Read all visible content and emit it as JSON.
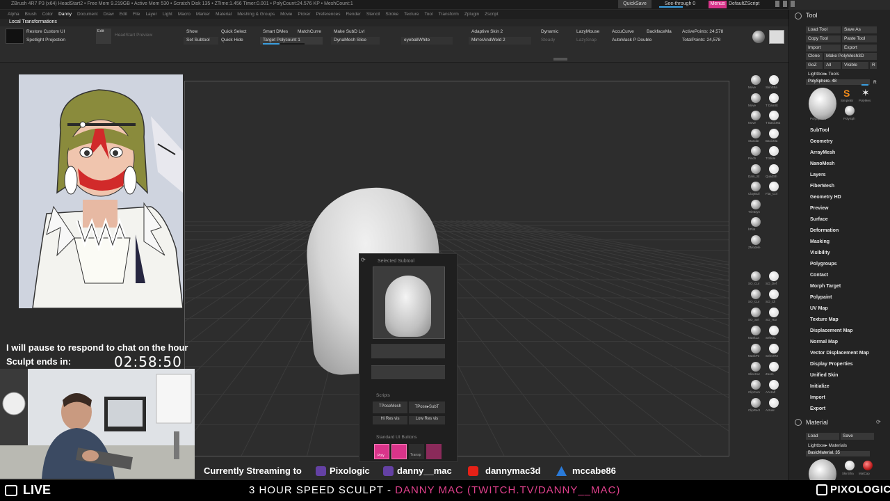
{
  "titlebar": {
    "text": "ZBrush 4R7 P3 (x64)   HeadStart2   • Free Mem 9.219GB • Active Mem 530 • Scratch Disk 135 • ZTime:1.456 Timer:0.001 • PolyCount:24.576 KP • MeshCount:1",
    "quicksave": "QuickSave",
    "seethrough": "See-through 0",
    "menus": "Menus",
    "default_script": "DefaultZScript"
  },
  "menubar": [
    "Alpha",
    "Brush",
    "Color",
    "Danny",
    "Document",
    "Draw",
    "Edit",
    "File",
    "Layer",
    "Light",
    "Macro",
    "Marker",
    "Material",
    "Meshing & Groups",
    "Movie",
    "Picker",
    "Preferences",
    "Render",
    "Stencil",
    "Stroke",
    "Texture",
    "Tool",
    "Transform",
    "Zplugin",
    "Zscript"
  ],
  "menubar_active": "Danny",
  "subbar": "Local Transformations",
  "shelf": {
    "restore_custom_ui": "Restore Custom UI",
    "spotlight_projection": "Spotlight Projection",
    "edit": "Edit",
    "headstart_preview": "HeadStart Preview",
    "show": "Show",
    "quick_select": "Quick Select",
    "set_subtool": "Set Subtool",
    "quick_hide": "Quick Hide",
    "smart_dmesh": "Smart DMes",
    "match_curve": "MatchCurre",
    "make_subd_lvl": "Make SubD Lvl",
    "target_polycount": "Target Polycount 1",
    "dynamesh_slice": "DynaMesh Slice",
    "eyeball_white": "eyeballWhite",
    "adaptive_skin": "Adaptive Skin 2",
    "dynamic": "Dynamic",
    "lazymouse": "LazyMouse",
    "accucurve": "AccuCurve",
    "backface_mask": "BackfaceMa",
    "active_points": "ActivePoints: 24,578",
    "mirror_and_weld": "MirrorAndWeld 2",
    "steady": "Steady",
    "lazysnap": "LazySnap",
    "automask_p_double": "AutoMask P Double",
    "total_points": "TotalPoints: 24,578"
  },
  "brushes": [
    {
      "a": "Move",
      "b": "SkinSha"
    },
    {
      "a": "Move",
      "b": "T DamSt"
    },
    {
      "a": "Move",
      "b": "T BasicMa"
    },
    {
      "a": "Standar",
      "b": "BasicMa"
    },
    {
      "a": "Pinch",
      "b": "TrSlide"
    },
    {
      "a": "Dam_St",
      "b": "QuadSh"
    },
    {
      "a": "ClayBuil",
      "b": "Flat_Col"
    },
    {
      "a": "TrimDyn",
      "b": ""
    },
    {
      "a": "hPlat",
      "b": ""
    },
    {
      "a": "ZModele",
      "b": ""
    }
  ],
  "brushes_lower": [
    {
      "a": "SO_Cur",
      "b": "SO_Def"
    },
    {
      "a": "SO_Cur",
      "b": "SO_Cli"
    },
    {
      "a": "SO_Sel",
      "b": "SO_Har"
    },
    {
      "a": "MaskLa",
      "b": "SelectL"
    },
    {
      "a": "MaskPe",
      "b": "SelectRe"
    },
    {
      "a": "SliceCur",
      "b": "Zoom"
    },
    {
      "a": "ClipCurv",
      "b": "AAHalf"
    },
    {
      "a": "ClipRect",
      "b": "Actual"
    }
  ],
  "tool": {
    "title": "Tool",
    "load_tool": "Load Tool",
    "save_as": "Save As",
    "copy_tool": "Copy Tool",
    "paste_tool": "Paste Tool",
    "import": "Import",
    "export": "Export",
    "clone": "Clone",
    "make_polymesh3d": "Make PolyMesh3D",
    "goz": "GoZ",
    "all": "All",
    "visible": "Visible",
    "r": "R",
    "lightbox_tools": "Lightbox▸ Tools",
    "current_tool": "PolySphere. 48",
    "thumb_labels": [
      "PolySphere",
      "SimpleBr",
      "PolyMes",
      "PolySph"
    ],
    "sections": [
      "SubTool",
      "Geometry",
      "ArrayMesh",
      "NanoMesh",
      "Layers",
      "FiberMesh",
      "Geometry HD",
      "Preview",
      "Surface",
      "Deformation",
      "Masking",
      "Visibility",
      "Polygroups",
      "Contact",
      "Morph Target",
      "Polypaint",
      "UV Map",
      "Texture Map",
      "Displacement Map",
      "Normal Map",
      "Vector Displacement Map",
      "Display Properties",
      "Unified Skin",
      "Initialize",
      "Import",
      "Export"
    ]
  },
  "material": {
    "title": "Material",
    "load": "Load",
    "save": "Save",
    "lightbox_materials": "Lightbox▸ Materials",
    "current": "BasicMaterial. 35",
    "thumb_labels": [
      "SkinSha",
      "MatCap"
    ]
  },
  "popup": {
    "title": "Selected Subtool",
    "scripts_label": "Scripts",
    "tposemesh": "TPoseMesh",
    "tpose_subt": "TPose▸SubT",
    "hi_res_vis": "Hi Res vis",
    "low_res_vis": "Low Res vis",
    "standard_ui_label": "Standard UI Buttons",
    "btn1": "Poly",
    "btn2": "",
    "btn3": "Transp"
  },
  "overlay": {
    "chat_message": "I will pause to respond to chat on the hour",
    "sculpt_label": "Sculpt ends in:",
    "timer": "02:58:50",
    "streaming_to": "Currently Streaming to",
    "channels": [
      {
        "name": "Pixologic",
        "color": "#6441a4",
        "icon": "twitch-icon"
      },
      {
        "name": "danny__mac",
        "color": "#6441a4",
        "icon": "twitch-icon"
      },
      {
        "name": "dannymac3d",
        "color": "#e62117",
        "icon": "youtube-icon"
      },
      {
        "name": "mccabe86",
        "color": "#2a7ad8",
        "icon": "artstation-icon"
      }
    ]
  },
  "footer": {
    "live": "LIVE",
    "title_white": "3 HOUR SPEED SCULPT - ",
    "title_pink": "DANNY MAC (TWITCH.TV/DANNY__MAC)",
    "brand": "PIXOLOGIC"
  },
  "colors": {
    "accent_pink": "#d9348a",
    "accent_blue": "#3a9fe0",
    "background": "#2a2a2a"
  }
}
